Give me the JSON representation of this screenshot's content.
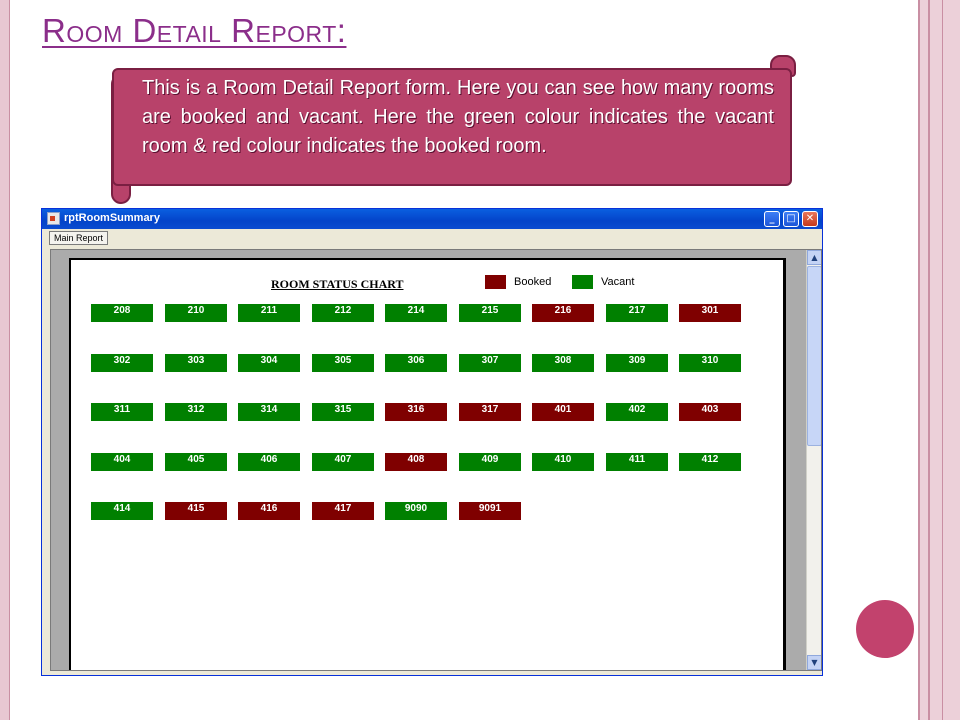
{
  "slide": {
    "title": "Room Detail Report:",
    "callout_text": "This is a Room Detail Report form. Here you can see how many rooms are booked and vacant. Here the green colour indicates the  vacant room & red colour indicates the booked room."
  },
  "window": {
    "title": "rptRoomSummary",
    "toolbar_button": "Main Report",
    "title_bar_color": "#0a4bd0"
  },
  "report": {
    "title": "ROOM STATUS CHART",
    "legend": [
      {
        "label": "Booked",
        "color": "#7f0000"
      },
      {
        "label": "Vacant",
        "color": "#008000"
      }
    ],
    "colors": {
      "booked": "#7f0000",
      "vacant": "#008000"
    },
    "rows": [
      [
        {
          "room": "208",
          "status": "vacant"
        },
        {
          "room": "210",
          "status": "vacant"
        },
        {
          "room": "211",
          "status": "vacant"
        },
        {
          "room": "212",
          "status": "vacant"
        },
        {
          "room": "214",
          "status": "vacant"
        },
        {
          "room": "215",
          "status": "vacant"
        },
        {
          "room": "216",
          "status": "booked"
        },
        {
          "room": "217",
          "status": "vacant"
        },
        {
          "room": "301",
          "status": "booked"
        }
      ],
      [
        {
          "room": "302",
          "status": "vacant"
        },
        {
          "room": "303",
          "status": "vacant"
        },
        {
          "room": "304",
          "status": "vacant"
        },
        {
          "room": "305",
          "status": "vacant"
        },
        {
          "room": "306",
          "status": "vacant"
        },
        {
          "room": "307",
          "status": "vacant"
        },
        {
          "room": "308",
          "status": "vacant"
        },
        {
          "room": "309",
          "status": "vacant"
        },
        {
          "room": "310",
          "status": "vacant"
        }
      ],
      [
        {
          "room": "311",
          "status": "vacant"
        },
        {
          "room": "312",
          "status": "vacant"
        },
        {
          "room": "314",
          "status": "vacant"
        },
        {
          "room": "315",
          "status": "vacant"
        },
        {
          "room": "316",
          "status": "booked"
        },
        {
          "room": "317",
          "status": "booked"
        },
        {
          "room": "401",
          "status": "booked"
        },
        {
          "room": "402",
          "status": "vacant"
        },
        {
          "room": "403",
          "status": "booked"
        }
      ],
      [
        {
          "room": "404",
          "status": "vacant"
        },
        {
          "room": "405",
          "status": "vacant"
        },
        {
          "room": "406",
          "status": "vacant"
        },
        {
          "room": "407",
          "status": "vacant"
        },
        {
          "room": "408",
          "status": "booked"
        },
        {
          "room": "409",
          "status": "vacant"
        },
        {
          "room": "410",
          "status": "vacant"
        },
        {
          "room": "411",
          "status": "vacant"
        },
        {
          "room": "412",
          "status": "vacant"
        }
      ],
      [
        {
          "room": "414",
          "status": "vacant"
        },
        {
          "room": "415",
          "status": "booked"
        },
        {
          "room": "416",
          "status": "booked"
        },
        {
          "room": "417",
          "status": "booked"
        },
        {
          "room": "9090",
          "status": "vacant"
        },
        {
          "room": "9091",
          "status": "booked"
        }
      ]
    ]
  }
}
